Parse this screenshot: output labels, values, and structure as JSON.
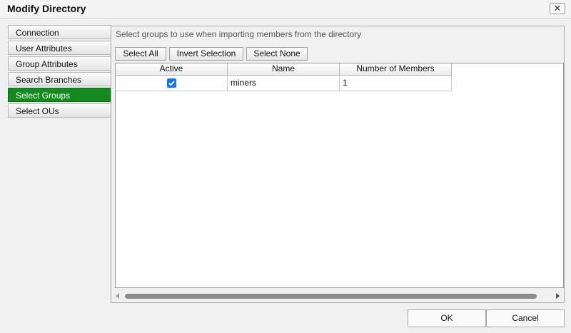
{
  "window": {
    "title": "Modify Directory",
    "close_glyph": "✕",
    "close_icon": "close-icon"
  },
  "sidebar": {
    "active_color": "#148a1e",
    "items": [
      {
        "label": "Connection",
        "active": false
      },
      {
        "label": "User Attributes",
        "active": false
      },
      {
        "label": "Group Attributes",
        "active": false
      },
      {
        "label": "Search Branches",
        "active": false
      },
      {
        "label": "Select Groups",
        "active": true
      },
      {
        "label": "Select OUs",
        "active": false
      }
    ]
  },
  "main": {
    "instructions": "Select groups to use when importing members from the directory",
    "buttons": {
      "select_all": "Select All",
      "invert_selection": "Invert Selection",
      "select_none": "Select None"
    },
    "table": {
      "columns": [
        "Active",
        "Name",
        "Number of Members"
      ],
      "rows": [
        {
          "active": true,
          "name": "miners",
          "members": "1"
        }
      ],
      "checkbox_color": "#1a73e8"
    }
  },
  "footer": {
    "ok_label": "OK",
    "cancel_label": "Cancel"
  }
}
